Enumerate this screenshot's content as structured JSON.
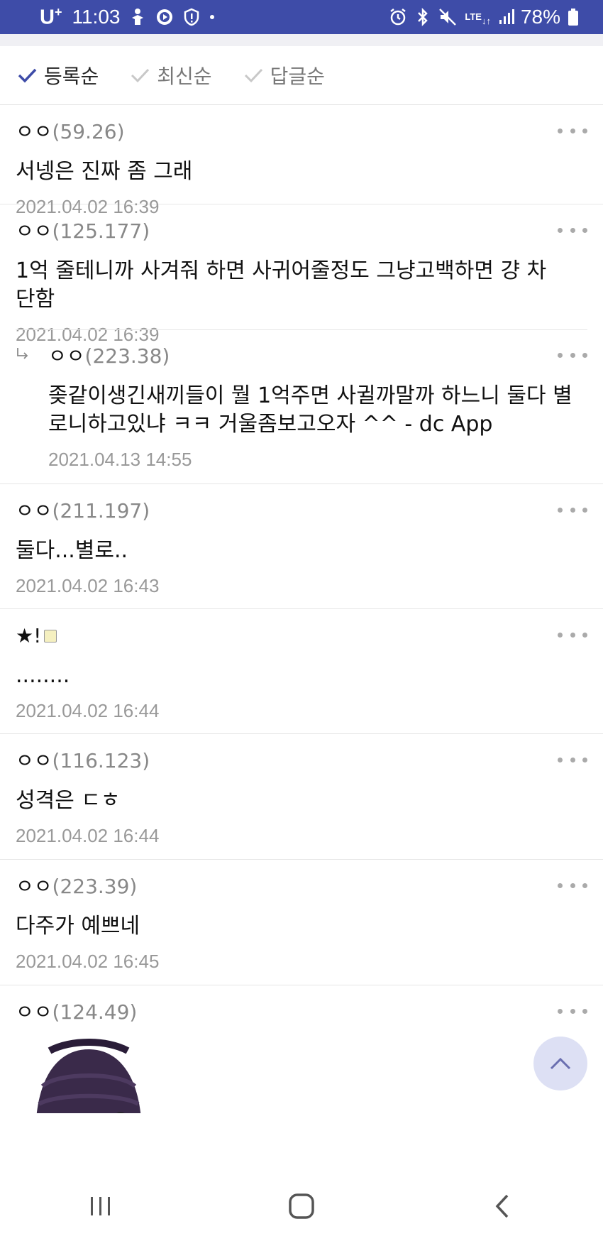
{
  "status_bar": {
    "carrier": "U",
    "carrier_sup": "+",
    "time": "11:03",
    "network": "LTE",
    "battery": "78%"
  },
  "sort": {
    "options": [
      {
        "label": "등록순",
        "active": true
      },
      {
        "label": "최신순",
        "active": false
      },
      {
        "label": "답글순",
        "active": false
      }
    ]
  },
  "comments": [
    {
      "name": "ㅇㅇ",
      "ip": "(59.26)",
      "text": "서넹은 진짜 좀 그래",
      "date": "2021.04.02 16:39"
    },
    {
      "name": "ㅇㅇ",
      "ip": "(125.177)",
      "text": "1억 줄테니까 사겨줘 하면 사귀어줄정도 그냥고백하면 걍 차단함",
      "date": "2021.04.02 16:39"
    },
    {
      "name": "ㅇㅇ",
      "ip": "(223.38)",
      "text": "좆같이생긴새끼들이 뭘 1억주면 사귈까말까 하느니 둘다 별로니하고있냐 ㅋㅋ 거울좀보고오자 ^^ - dc App",
      "date": "2021.04.13 14:55",
      "reply": true
    },
    {
      "name": "ㅇㅇ",
      "ip": "(211.197)",
      "text": "둘다...별로..",
      "date": "2021.04.02 16:43"
    },
    {
      "name": "★!",
      "ip": "",
      "text": "........",
      "date": "2021.04.02 16:44"
    },
    {
      "name": "ㅇㅇ",
      "ip": "(116.123)",
      "text": "성격은 ㄷㅎ",
      "date": "2021.04.02 16:44"
    },
    {
      "name": "ㅇㅇ",
      "ip": "(223.39)",
      "text": "다주가 예쁘네",
      "date": "2021.04.02 16:45"
    },
    {
      "name": "ㅇㅇ",
      "ip": "(124.49)",
      "text": "",
      "date": ""
    }
  ],
  "icons": {
    "sort_check": "check-icon",
    "more": "more-dots-icon",
    "reply": "reply-arrow-icon",
    "scroll_top": "chevron-up-icon",
    "nav_recent": "recent-apps-icon",
    "nav_home": "home-icon",
    "nav_back": "back-icon"
  },
  "colors": {
    "status_bar": "#3e4ca8",
    "accent_check": "#3e4ca8"
  }
}
